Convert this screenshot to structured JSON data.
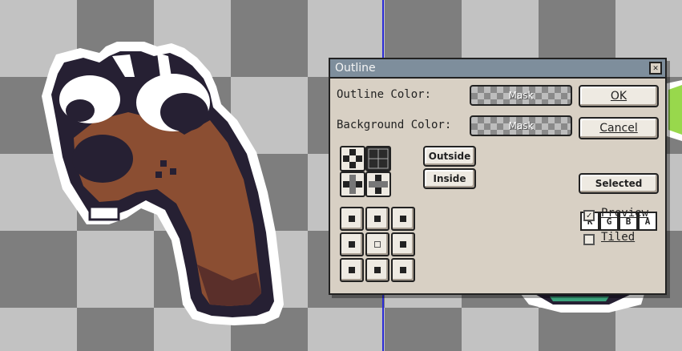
{
  "dialog": {
    "title": "Outline",
    "close_glyph": "✕",
    "outline_color_label": "Outline Color:",
    "outline_color_value": "Mask",
    "background_color_label": "Background Color:",
    "background_color_value": "Mask",
    "ok_label": "OK",
    "cancel_label": "Cancel",
    "place_outside_label": "Outside",
    "place_inside_label": "Inside",
    "channels": [
      "R",
      "G",
      "B",
      "A"
    ],
    "selected_label": "Selected",
    "preview_label": "Preview",
    "preview_checked": true,
    "tiled_label": "Tiled",
    "tiled_checked": false,
    "check_glyph": "✓"
  },
  "colors": {
    "title_bar": "#7e8e9c",
    "dialog_bg": "#d8d0c4",
    "guide_line": "#2b2bd6"
  }
}
